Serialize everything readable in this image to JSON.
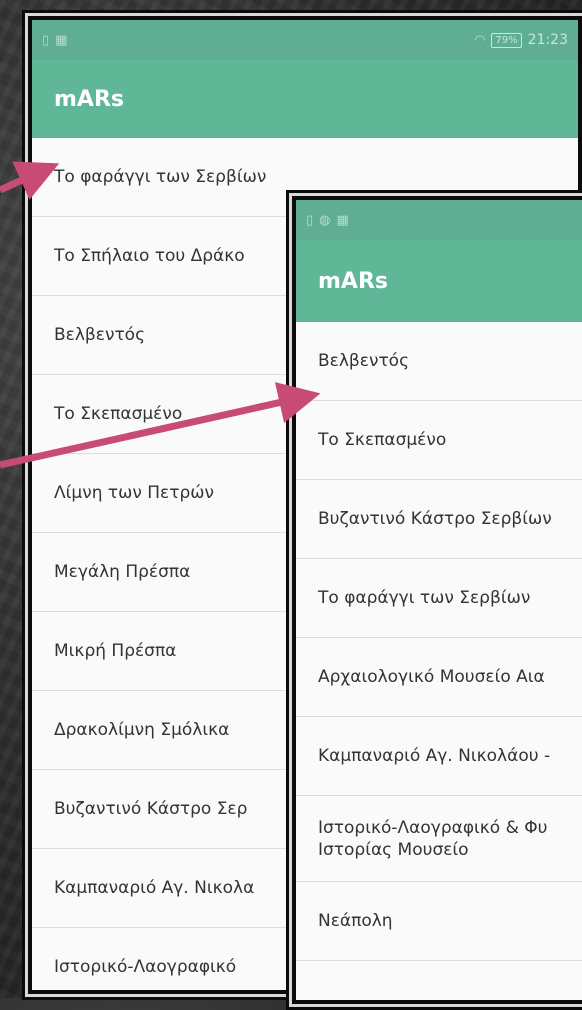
{
  "background": {
    "color": "#2e2e2e"
  },
  "phone_a": {
    "status": {
      "left_icons": [
        "sim-icon",
        "map-icon"
      ],
      "wifi": "wifi-icon",
      "battery": "79%",
      "time": "21:23"
    },
    "app_title": "mARs",
    "items": [
      "Το φαράγγι των Σερβίων",
      "Το Σπήλαιο του Δράκο",
      "Βελβεντός",
      "Το Σκεπασμένο",
      "Λίμνη των Πετρών",
      "Μεγάλη Πρέσπα",
      "Μικρή Πρέσπα",
      "Δρακολίμνη Σμόλικα",
      "Βυζαντινό Κάστρο Σερ",
      "Καμπαναριό Αγ. Νικολα",
      "Ιστορικό-Λαογραφικό"
    ]
  },
  "phone_b": {
    "status": {
      "left_icons": [
        "sim-icon",
        "globe-icon",
        "map-icon"
      ]
    },
    "app_title": "mARs",
    "items": [
      "Βελβεντός",
      "Το Σκεπασμένο",
      "Βυζαντινό Κάστρο Σερβίων",
      "Το φαράγγι των Σερβίων",
      "Αρχαιολογικό Μουσείο Αια",
      "Καμπαναριό Αγ. Νικολάου -",
      "Ιστορικό-Λαογραφικό & Φυ Ιστορίας Μουσείο",
      "Νεάπολη"
    ]
  },
  "colors": {
    "accent": "#5fb798",
    "status": "#5fae93",
    "arrow": "#c74b73"
  }
}
